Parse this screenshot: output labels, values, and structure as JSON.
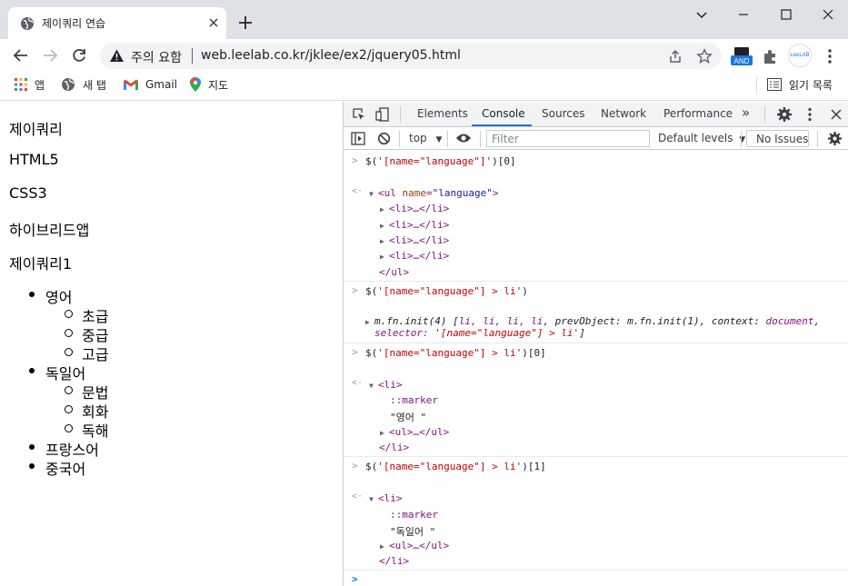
{
  "browser": {
    "tab_title": "제이쿼리 연습",
    "security_label": "주의 요함",
    "url": "web.leelab.co.kr/jklee/ex2/jquery05.html",
    "extension_badge": "AND",
    "profile_label": "LeeLAB"
  },
  "bookmarks": {
    "items": [
      {
        "label": "앱",
        "icon": "apps-grid-icon"
      },
      {
        "label": "새 탭",
        "icon": "globe-icon"
      },
      {
        "label": "Gmail",
        "icon": "gmail-icon"
      },
      {
        "label": "지도",
        "icon": "maps-pin-icon"
      }
    ],
    "reading_list": "읽기 목록"
  },
  "page": {
    "paragraphs": [
      "제이쿼리",
      "HTML5",
      "CSS3",
      "하이브리드앱",
      "제이쿼리1"
    ],
    "list": {
      "item1": "영어",
      "item1_sub": [
        "초급",
        "중급",
        "고급"
      ],
      "item2": "독일어",
      "item2_sub": [
        "문법",
        "회화",
        "독해"
      ],
      "item3": "프랑스어",
      "item4": "중국어"
    }
  },
  "devtools": {
    "tabs": [
      "Elements",
      "Console",
      "Sources",
      "Network",
      "Performance"
    ],
    "active_tab": "Console",
    "more": "»",
    "context": "top",
    "filter_placeholder": "Filter",
    "levels": "Default levels",
    "issues": "No Issues"
  },
  "console": {
    "cmd1_pre": "$(",
    "cmd1_str": "'[name=\"language\"]'",
    "cmd1_post": ")[0]",
    "ul_tag": "<ul",
    "ul_attr": "name",
    "ul_eq": "=",
    "ul_val": "\"language\"",
    "ul_close": ">",
    "li_collapsed": "<li>…</li>",
    "ul_end": "</ul>",
    "cmd2_pre": "$(",
    "cmd2_str": "'[name=\"language\"] > li'",
    "cmd2_post": ")",
    "init_a": "m.fn.init(4) [",
    "init_b": "li, li, li, li",
    "init_c": ", prevObject: ",
    "init_d": "m.fn.init(1)",
    "init_e": ", context: ",
    "init_f": "document",
    "init_g": ",",
    "init_sel": "selector: ",
    "init_sel_val": "'[name=\"language\"] > li'",
    "init_end": "]",
    "cmd3_pre": "$(",
    "cmd3_str": "'[name=\"language\"] > li'",
    "cmd3_post": ")[0]",
    "li_open": "<li>",
    "marker": "::marker",
    "text_en": "\"영어 \"",
    "ul_collapsed": "<ul>…</ul>",
    "li_close": "</li>",
    "cmd4_pre": "$(",
    "cmd4_str": "'[name=\"language\"] > li'",
    "cmd4_post": ")[1]",
    "text_de": "\"독일어 \"",
    "prompt": ">",
    "return": "<·"
  },
  "colors": {
    "accent": "#1a73e8",
    "tag": "#881280",
    "string": "#c80000"
  }
}
